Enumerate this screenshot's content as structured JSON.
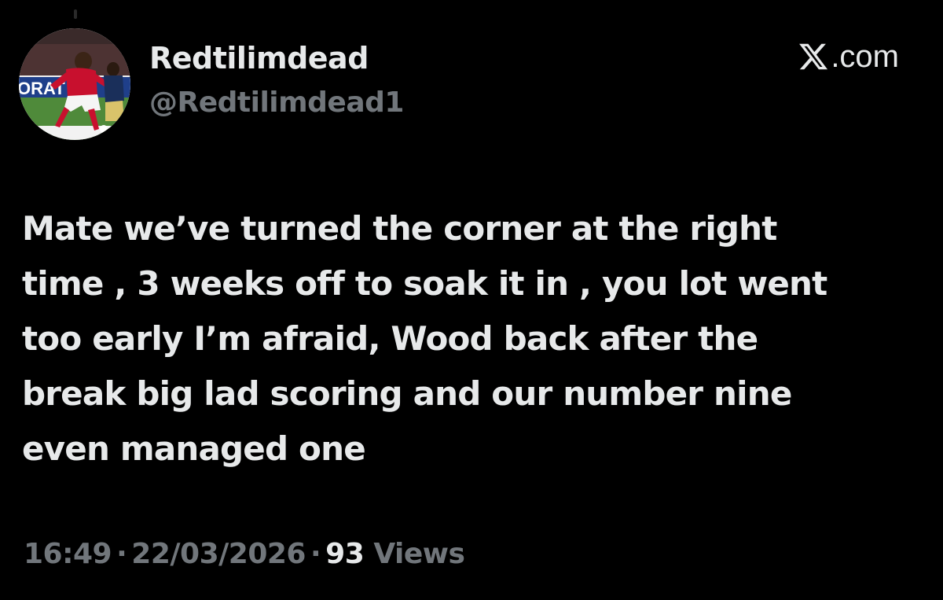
{
  "author": {
    "display_name": "Redtilimdead",
    "handle": "@Redtilimdead1",
    "avatar_icon": "avatar-photo-footballer"
  },
  "brand": {
    "icon": "x-logo-icon",
    "text": ".com"
  },
  "tweet": {
    "text": "Mate we’ve turned the corner at the right\ntime , 3 weeks off to soak it in  , you lot went\ntoo early I’m afraid, Wood back after the\nbreak big lad scoring and our number nine\neven managed one"
  },
  "meta": {
    "time": "16:49",
    "separator": "·",
    "date": "22/03/2026",
    "views_count": "93",
    "views_label": "Views"
  },
  "colors": {
    "background": "#000000",
    "primary_text": "#e7e9ea",
    "secondary_text": "#71767b"
  }
}
